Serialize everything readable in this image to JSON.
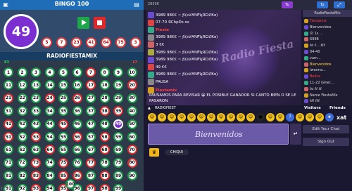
{
  "bingo": {
    "title": "BINGO 100",
    "current_ball": "49",
    "recent_balls": [
      "5",
      "7",
      "23",
      "41",
      "64",
      "75",
      "3"
    ],
    "board_title": "RADIOFIESTAMIX",
    "count_left": "83",
    "count_right": "17",
    "called_numbers": [
      7,
      17,
      20,
      21,
      24,
      26,
      38,
      39,
      41,
      45,
      49,
      51,
      53,
      56,
      58,
      64,
      68,
      70,
      73,
      75,
      77,
      80,
      83,
      85,
      86,
      88,
      93,
      95,
      97,
      98
    ],
    "current_number": 49,
    "footer": "7.3"
  },
  "chat": {
    "room_id": "28596",
    "messages": [
      {
        "user": "3989",
        "text": "98€€ ~ ƒί(ѕѴ₳ℕ₱ʯЯѺℭ₭ǝ)"
      },
      {
        "user": "07-70",
        "text": "ЯChpDs os"
      },
      {
        "user": "Fiesta",
        "text": ""
      },
      {
        "user": "3989",
        "text": "98€€ ~ ƒί(ѕѴ₳ℕ₱ʯЯѺℭ₭ǝ)"
      },
      {
        "user": "3 €€",
        "text": ""
      },
      {
        "user": "3989",
        "text": "98€€ ~ ƒί(ѕѴ₳ℕ₱ʯЯѺℭ₭ǝ)"
      },
      {
        "user": "3989",
        "text": "98€€ ~ ƒί(ѕѴ₳ℕ₱ʯЯѺℭ₭ǝ)"
      },
      {
        "user": "49 €€",
        "text": ""
      },
      {
        "user": "3989",
        "text": "98€€ ~ ƒί(ѕѴ₳ℕ₱ʯЯѺℭ₭ǝ)"
      },
      {
        "user": "PAUSA",
        "text": ""
      }
    ],
    "fiestamix_name": "Fiestamix",
    "pausa_msg": "PAUSAMOS PARA REVISAR 😀 EL POSIBLE GANADOR SI CANTO BIEN O SE LE PASARON",
    "tab_label": "RADIOFIEST",
    "input_text": "Bienvenidos",
    "chip_label": "CHIQUI",
    "visitors_label": "Visitors",
    "friends_label": "Friends",
    "edit_chat_label": "Edit Your Chat",
    "sign_out_label": "Sign Out",
    "xat_label": "xat",
    "users_header": "RadioFiestaMix",
    "users": [
      {
        "name": "Fiestamix",
        "color": "#ff4040"
      },
      {
        "name": "Bienvenidos",
        "color": "#ddd"
      },
      {
        "name": "Ⓡ 1s ...",
        "color": "#ddd"
      },
      {
        "name": "6998",
        "color": "#ddd"
      },
      {
        "name": "ℓα ℓ... ℓℓℓ",
        "color": "#ddd"
      },
      {
        "name": "04-40",
        "color": "#ddd"
      },
      {
        "name": "vam...",
        "color": "#ddd"
      },
      {
        "name": "Bienvenidos",
        "color": "#ffd54a"
      },
      {
        "name": "Iwanna...",
        "color": "#ddd"
      },
      {
        "name": "Belica",
        "color": "#ff4040"
      },
      {
        "name": "11-22 Giner...",
        "color": "#ddd"
      },
      {
        "name": "ℓα ℓℓ ℓℓ",
        "color": "#ddd"
      },
      {
        "name": "Name FiestaMix",
        "color": "#ddd"
      },
      {
        "name": "ℓℓℓ ℓℓℓ",
        "color": "#ddd"
      }
    ]
  }
}
